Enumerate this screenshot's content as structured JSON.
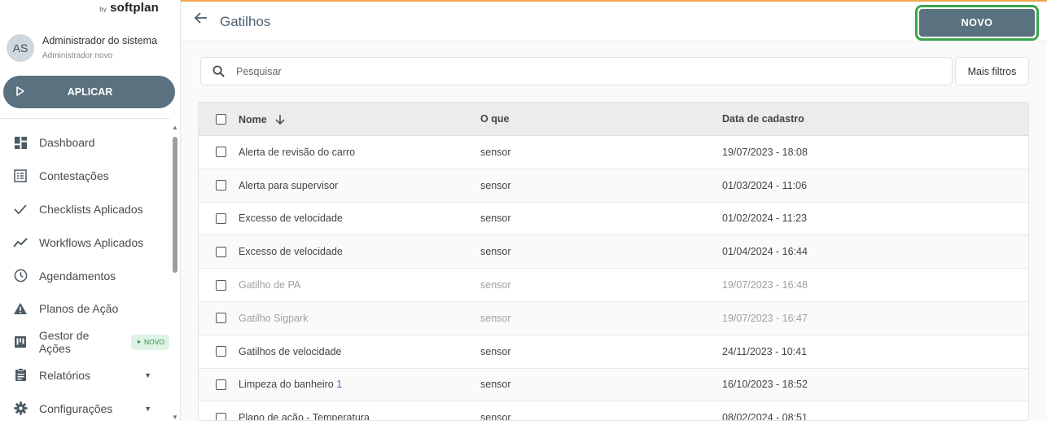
{
  "brand": {
    "by": "by",
    "name": "softplan"
  },
  "user": {
    "initials": "AS",
    "name": "Administrador do sistema",
    "role": "Administrador novo"
  },
  "apply_button": {
    "label": "APLICAR",
    "icon": "play-icon"
  },
  "nav": [
    {
      "label": "Dashboard",
      "icon": "dashboard-icon"
    },
    {
      "label": "Contestações",
      "icon": "list-icon"
    },
    {
      "label": "Checklists Aplicados",
      "icon": "check-icon"
    },
    {
      "label": "Workflows Aplicados",
      "icon": "trending-icon"
    },
    {
      "label": "Agendamentos",
      "icon": "clock-icon"
    },
    {
      "label": "Planos de Ação",
      "icon": "warning-icon"
    },
    {
      "label": "Gestor de Ações",
      "icon": "kanban-icon",
      "badge": "NOVO"
    },
    {
      "label": "Relatórios",
      "icon": "clipboard-icon",
      "expandable": true
    },
    {
      "label": "Configurações",
      "icon": "gear-icon",
      "expandable": true
    }
  ],
  "header": {
    "title": "Gatilhos",
    "new_button": "NOVO"
  },
  "search": {
    "placeholder": "Pesquisar",
    "value": ""
  },
  "filters_button": "Mais filtros",
  "table": {
    "columns": [
      "Nome",
      "O que",
      "Data de cadastro"
    ],
    "rows": [
      {
        "name": "Alerta de revisão do carro",
        "what": "sensor",
        "date": "19/07/2023 - 18:08"
      },
      {
        "name": "Alerta para supervisor",
        "what": "sensor",
        "date": "01/03/2024 - 11:06"
      },
      {
        "name": "Excesso de velocidade",
        "what": "sensor",
        "date": "01/02/2024 - 11:23"
      },
      {
        "name": "Excesso de velocidade",
        "what": "sensor",
        "date": "01/04/2024 - 16:44"
      },
      {
        "name": "Gatilho de PA",
        "what": "sensor",
        "date": "19/07/2023 - 16:48",
        "inactive": true
      },
      {
        "name": "Gatilho Sigpark",
        "what": "sensor",
        "date": "19/07/2023 - 16:47",
        "inactive": true
      },
      {
        "name": "Gatilhos de velocidade",
        "what": "sensor",
        "date": "24/11/2023 - 10:41"
      },
      {
        "name_prefix": "Limpeza do banheiro ",
        "name_suffix": "1",
        "what": "sensor",
        "date": "16/10/2023 - 18:52"
      },
      {
        "name": "Plano de ação - Temperatura",
        "what": "sensor",
        "date": "08/02/2024 - 08:51"
      }
    ]
  },
  "colors": {
    "primary": "#5a7180",
    "highlight": "#3aa54c",
    "accent_top": "#f0a64a"
  }
}
